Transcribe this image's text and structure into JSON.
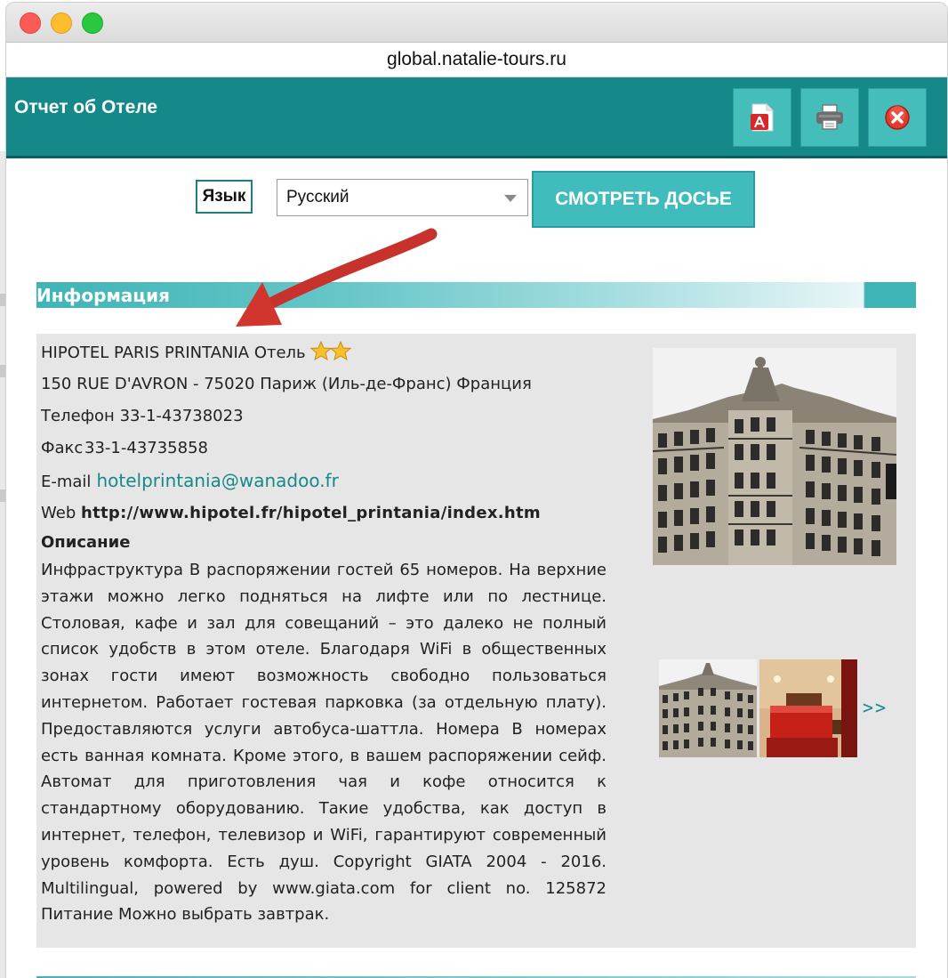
{
  "browser": {
    "url": "global.natalie-tours.ru"
  },
  "header": {
    "title": "Отчет об Отеле",
    "buttons": [
      {
        "icon": "pdf-icon"
      },
      {
        "icon": "print-icon"
      },
      {
        "icon": "close-circle-icon"
      }
    ],
    "color": "#15898a"
  },
  "toolbar": {
    "language_label": "Язык",
    "language_value": "Русский",
    "dossier_button": "СМОТРЕТЬ ДОСЬЕ"
  },
  "section": {
    "title": "Информация"
  },
  "hotel": {
    "name_line": "HIPOTEL PARIS PRINTANIA Отель",
    "stars": 2,
    "address": "150 RUE D'AVRON - 75020 Париж (Иль-де-Франс) Франция",
    "phone_label": "Телефон",
    "phone": "33-1-43738023",
    "fax_label": "Факс",
    "fax": "33-1-43735858",
    "email_label": "E-mail",
    "email": "hotelprintania@wanadoo.fr",
    "web_label": "Web",
    "web": "http://www.hipotel.fr/hipotel_printania/index.htm",
    "description_title": "Описание",
    "description": "Инфраструктура В распоряжении гостей 65 номеров. На верхние этажи можно легко подняться на лифте или по лестнице. Столовая, кафе и зал для совещаний – это далеко не полный список удобств в этом отеле. Благодаря WiFi в общественных зонах гости имеют возможность свободно пользоваться интернетом. Работает гостевая парковка (за отдельную плату). Предоставляются услуги автобуса-шаттла. Номера В номерах есть ванная комната. Кроме этого, в вашем распоряжении сейф. Автомат для приготовления чая и кофе относится к стандартному оборудованию. Такие удобства, как доступ в интернет, телефон, телевизор и WiFi, гарантируют современный уровень комфорта. Есть душ. Copyright GIATA 2004 - 2016. Multilingual, powered by www.giata.com for client no. 125872 Питание Можно выбрать завтрак."
  },
  "gallery": {
    "more_label": ">>"
  },
  "accent_color": "#3fbcbb",
  "link_color": "#17898a"
}
